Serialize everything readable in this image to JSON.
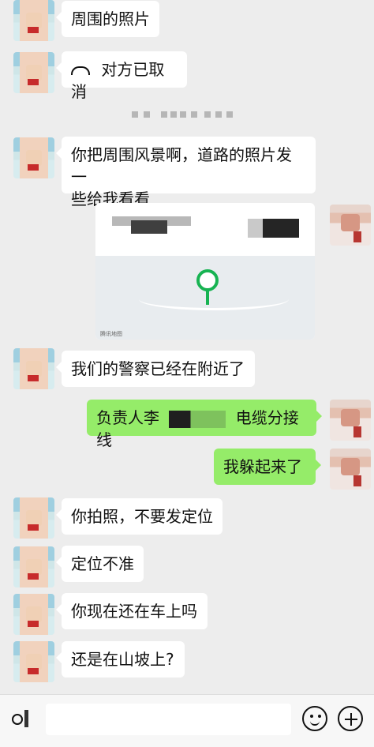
{
  "messages": [
    {
      "side": "left",
      "text": "周围的照片"
    },
    {
      "side": "left",
      "text": "对方已取消"
    },
    {
      "side": "left",
      "text_line1": "你把周围风景啊，道路的照片发一",
      "text_line2": "些给我看看"
    },
    {
      "side": "left",
      "text": "我们的警察已经在附近了"
    },
    {
      "side": "right",
      "text_a": "负责人李",
      "text_b": "电缆分接线"
    },
    {
      "side": "right",
      "text": "我躲起来了"
    },
    {
      "side": "left",
      "text": "你拍照，不要发定位"
    },
    {
      "side": "left",
      "text": "定位不准"
    },
    {
      "side": "left",
      "text": "你现在还在车上吗"
    },
    {
      "side": "left",
      "text": "还是在山坡上?"
    }
  ],
  "map_caption": "腾讯地图",
  "icons": {
    "call": "phone-hangup-icon",
    "voice": "voice-icon",
    "emoji": "emoji-icon",
    "plus": "plus-icon"
  },
  "colors": {
    "background": "#ededed",
    "my_bubble": "#95ec69",
    "pin": "#17b352"
  }
}
